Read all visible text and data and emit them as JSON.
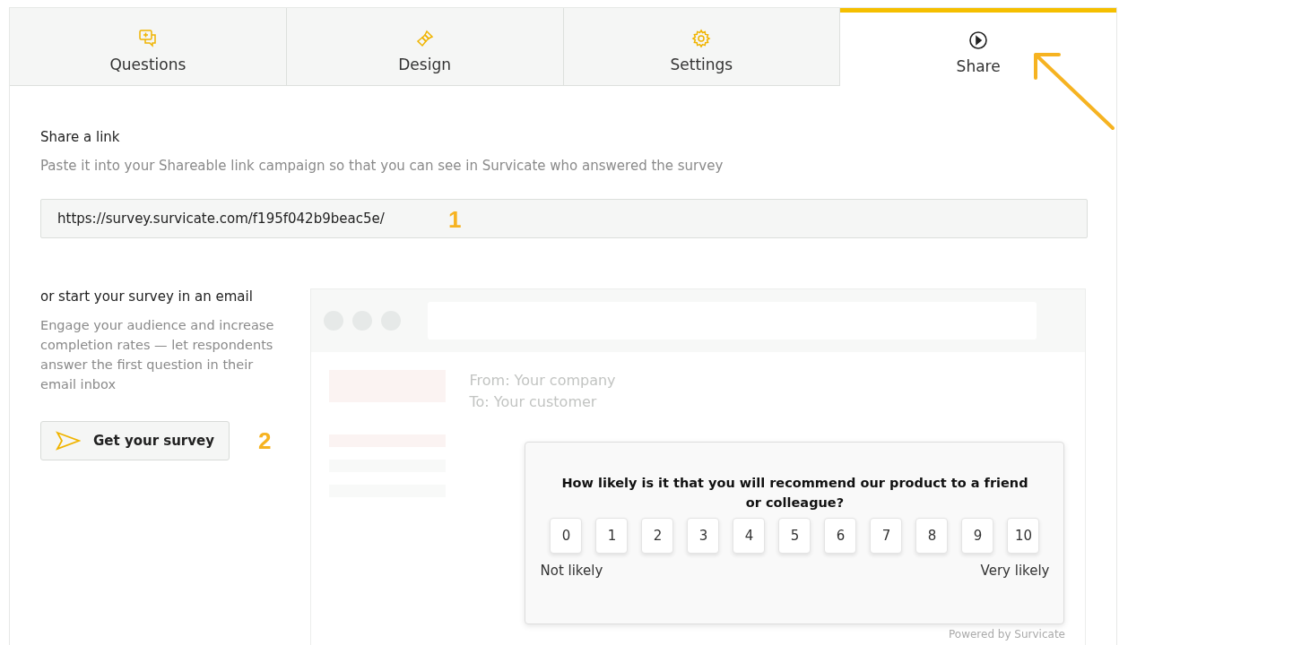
{
  "tabs": [
    {
      "label": "Questions",
      "kind": "questions",
      "selected": false
    },
    {
      "label": "Design",
      "kind": "design",
      "selected": false
    },
    {
      "label": "Settings",
      "kind": "settings",
      "selected": false
    },
    {
      "label": "Share",
      "kind": "share",
      "selected": true
    }
  ],
  "share_link": {
    "title": "Share a link",
    "description": "Paste it into your Shareable link campaign so that you can see in Survicate who answered the survey",
    "value": "https://survey.survicate.com/f195f042b9beac5e/",
    "step": "1"
  },
  "email": {
    "title": "or start your survey in an email",
    "description": "Engage your audience and increase completion rates — let respondents answer the first question in their email inbox",
    "button": "Get your survey",
    "step": "2"
  },
  "preview": {
    "from": "From: Your company",
    "to": "To: Your customer",
    "question": "How likely is it that you will recommend our product to a friend or colleague?",
    "scale": [
      "0",
      "1",
      "2",
      "3",
      "4",
      "5",
      "6",
      "7",
      "8",
      "9",
      "10"
    ],
    "low_label": "Not likely",
    "high_label": "Very likely",
    "footer": "Powered by Survicate"
  }
}
